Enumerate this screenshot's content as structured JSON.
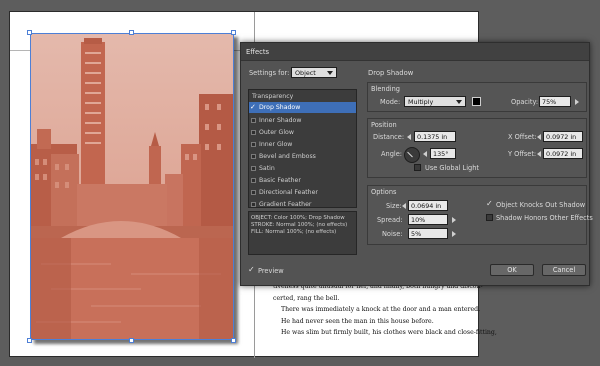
{
  "document": {
    "body_lines": [
      "tiveness quite unusual for her, and finally, both hungry and discon-",
      "certed, rang the bell.",
      "There was immediately a knock at the door and a man entered.",
      "He had never seen the man in this house before.",
      "He was slim but firmly built, his clothes were black and close-fitting,"
    ]
  },
  "dialog": {
    "title": "Effects",
    "settings_for_label": "Settings for:",
    "settings_for_value": "Object",
    "effect_heading": "Drop Shadow",
    "list_header": "Transparency",
    "effects": [
      {
        "label": "Drop Shadow",
        "checked": true,
        "selected": true
      },
      {
        "label": "Inner Shadow",
        "checked": false
      },
      {
        "label": "Outer Glow",
        "checked": false
      },
      {
        "label": "Inner Glow",
        "checked": false
      },
      {
        "label": "Bevel and Emboss",
        "checked": false
      },
      {
        "label": "Satin",
        "checked": false
      },
      {
        "label": "Basic Feather",
        "checked": false
      },
      {
        "label": "Directional Feather",
        "checked": false
      },
      {
        "label": "Gradient Feather",
        "checked": false
      }
    ],
    "summary_lines": [
      "OBJECT: Color 100%; Drop Shadow",
      "STROKE: Normal 100%; (no effects)",
      "FILL: Normal 100%; (no effects)"
    ],
    "blending": {
      "title": "Blending",
      "mode_label": "Mode:",
      "mode_value": "Multiply",
      "opacity_label": "Opacity:",
      "opacity_value": "75%",
      "color": "#000000"
    },
    "position": {
      "title": "Position",
      "distance_label": "Distance:",
      "distance_value": "0.1375 in",
      "angle_label": "Angle:",
      "angle_value": "135°",
      "x_offset_label": "X Offset:",
      "x_offset_value": "0.0972 in",
      "y_offset_label": "Y Offset:",
      "y_offset_value": "0.0972 in",
      "use_global_light_label": "Use Global Light"
    },
    "options": {
      "title": "Options",
      "size_label": "Size:",
      "size_value": "0.0694 in",
      "spread_label": "Spread:",
      "spread_value": "10%",
      "noise_label": "Noise:",
      "noise_value": "5%",
      "knocks_out_label": "Object Knocks Out Shadow",
      "knocks_out_checked": true,
      "honors_label": "Shadow Honors Other Effects"
    },
    "preview_label": "Preview",
    "ok_label": "OK",
    "cancel_label": "Cancel"
  },
  "colors": {
    "image_tint": "#c9705a",
    "selection": "#3e6fb8",
    "frame_border": "#4d7fd6"
  }
}
